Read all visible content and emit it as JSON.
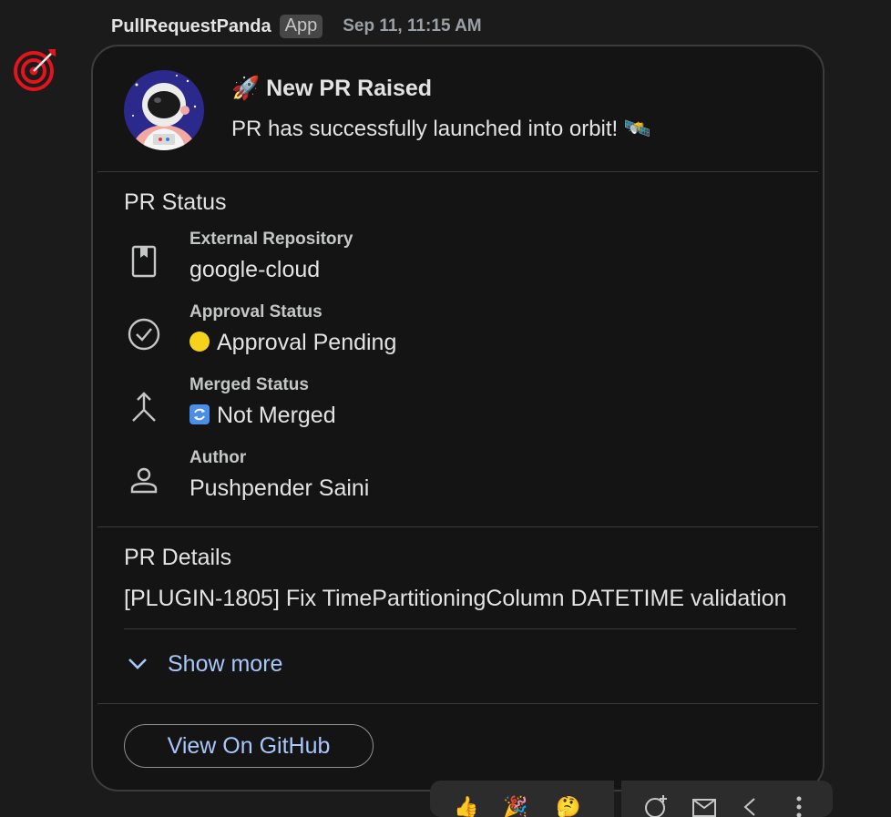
{
  "message": {
    "sender": "PullRequestPanda",
    "badge": "App",
    "timestamp": "Sep 11, 11:15 AM",
    "bot_avatar_icon": "target-icon"
  },
  "card": {
    "title": "🚀 New PR Raised",
    "subtitle": "PR has successfully launched into orbit! 🛰️",
    "avatar_icon": "astronaut-avatar",
    "status_section": {
      "title": "PR Status",
      "rows": [
        {
          "icon": "book-icon",
          "label": "External Repository",
          "value": "google-cloud"
        },
        {
          "icon": "check-circle-icon",
          "label": "Approval Status",
          "value": "Approval Pending",
          "emoji": "yellow-circle"
        },
        {
          "icon": "merge-icon",
          "label": "Merged Status",
          "value": "Not Merged",
          "emoji": "sync-arrows"
        },
        {
          "icon": "person-icon",
          "label": "Author",
          "value": "Pushpender Saini"
        }
      ]
    },
    "details_section": {
      "title": "PR Details",
      "text": "[PLUGIN-1805] Fix TimePartitioningColumn DATETIME validation",
      "show_more_label": "Show more"
    },
    "button_label": "View On GitHub"
  },
  "colors": {
    "background": "#1b1b1b",
    "card_background": "#141414",
    "link": "#a8c7fa",
    "text": "#e3e3e3",
    "muted": "#c4c7c5",
    "approval_dot": "#f7d21c",
    "bot_avatar": "#e3141c"
  }
}
